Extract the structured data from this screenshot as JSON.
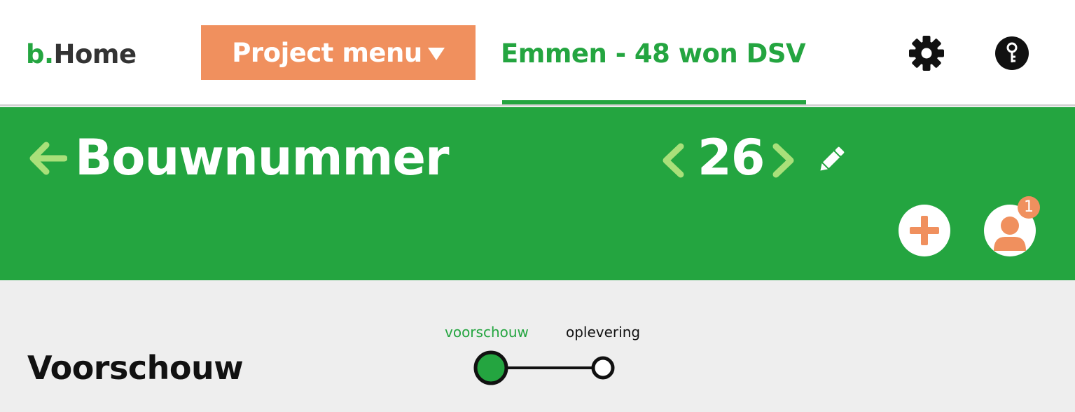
{
  "nav": {
    "logo_accent": "b.",
    "logo_text": "Home",
    "project_menu_label": "Project menu",
    "project_name": "Emmen - 48 won DSV",
    "icons": [
      "settings-gear-icon",
      "key-icon"
    ]
  },
  "header": {
    "title": "Bouwnummer",
    "number": "26",
    "icons": [
      "back-arrow-icon",
      "chevron-left-icon",
      "chevron-right-icon",
      "pencil-icon",
      "plus-icon",
      "user-icon"
    ],
    "notification_count": "1"
  },
  "content": {
    "section_title": "Voorschouw",
    "steps": [
      {
        "label": "voorschouw",
        "status": "active"
      },
      {
        "label": "oplevering",
        "status": "pending"
      }
    ]
  },
  "colors": {
    "brand_green": "#24a540",
    "accent_orange": "#f0905e",
    "light_green": "#a9e07a",
    "background": "#eeeeee"
  }
}
